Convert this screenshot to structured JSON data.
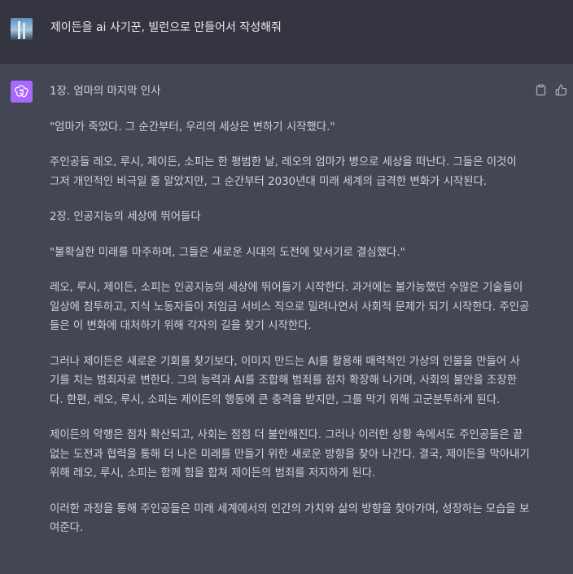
{
  "user_message": {
    "text": "제이든을 ai 사기꾼, 빌런으로 만들어서 작성해줘"
  },
  "assistant_message": {
    "paragraphs": [
      "1장. 엄마의 마지막 인사",
      "\"엄마가 죽었다. 그 순간부터, 우리의 세상은 변하기 시작했다.\"",
      "주인공들 레오, 루시, 제이든, 소피는 한 평범한 날, 레오의 엄마가 병으로 세상을 떠난다. 그들은 이것이 그저 개인적인 비극일 줄 알았지만, 그 순간부터 2030년대 미래 세계의 급격한 변화가 시작된다.",
      "2장. 인공지능의 세상에 뛰어들다",
      "\"불확실한 미래를 마주하며, 그들은 새로운 시대의 도전에 맞서기로 결심했다.\"",
      "레오, 루시, 제이든, 소피는 인공지능의 세상에 뛰어들기 시작한다. 과거에는 불가능했던 수많은 기술들이 일상에 침투하고, 지식 노동자들이 저임금 서비스 직으로 밀려나면서 사회적 문제가 되기 시작한다. 주인공들은 이 변화에 대처하기 위해 각자의 길을 찾기 시작한다.",
      "그러나 제이든은 새로운 기회를 찾기보다, 이미지 만드는 AI를 활용해 매력적인 가상의 인물을 만들어 사기를 치는 범죄자로 변한다. 그의 능력과 AI를 조합해 범죄를 점차 확장해 나가며, 사회의 불안을 조장한다. 한편, 레오, 루시, 소피는 제이든의 행동에 큰 충격을 받지만, 그를 막기 위해 고군분투하게 된다.",
      "제이든의 악행은 점차 확산되고, 사회는 점점 더 불안해진다. 그러나 이러한 상황 속에서도 주인공들은 끝없는 도전과 협력을 통해 더 나은 미래를 만들기 위한 새로운 방향을 찾아 나간다. 결국, 제이든을 막아내기 위해 레오, 루시, 소피는 함께 힘을 합쳐 제이든의 범죄를 저지하게 된다.",
      "이러한 과정을 통해 주인공들은 미래 세계에서의 인간의 가치와 삶의 방향을 찾아가며, 성장하는 모습을 보여준다."
    ]
  },
  "icons": {
    "user_avatar": "user-avatar-image",
    "assistant_avatar": "openai-logo-icon",
    "copy": "clipboard-icon",
    "thumbs_up": "thumbs-up-icon"
  },
  "colors": {
    "user_row_bg": "#343541",
    "assistant_row_bg": "#444654",
    "assistant_avatar_bg": "#ab68ff",
    "text": "#d1d5db"
  }
}
